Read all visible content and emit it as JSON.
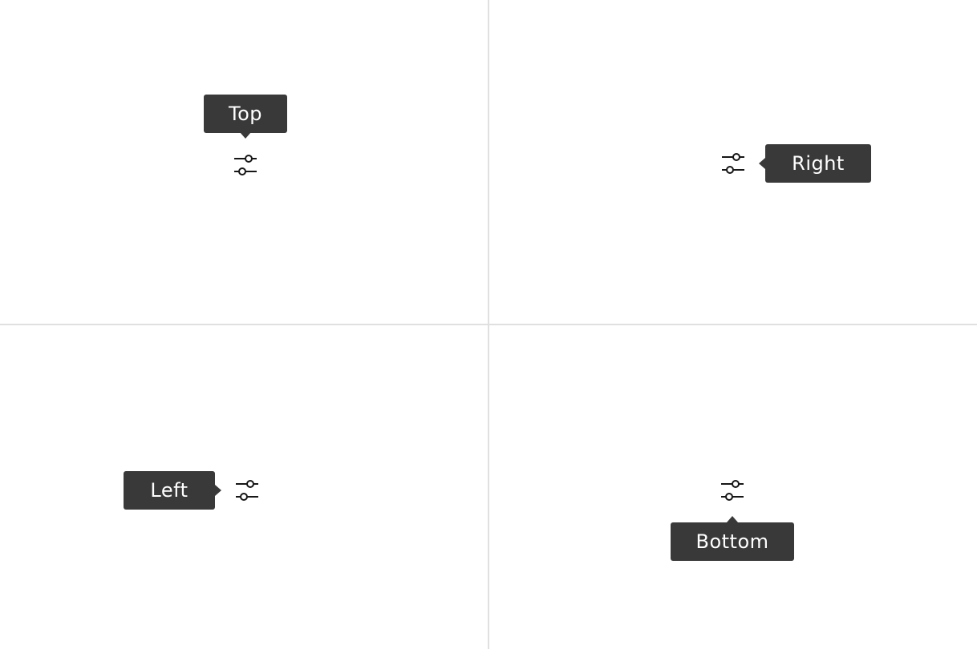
{
  "colors": {
    "tooltip_background": "#393939",
    "tooltip_text": "#ffffff",
    "divider": "#e0e0e0",
    "icon": "#161616",
    "background": "#ffffff"
  },
  "icon_name": "settings-adjust-icon",
  "quadrants": {
    "top": {
      "tooltip_label": "Top"
    },
    "right": {
      "tooltip_label": "Right"
    },
    "left": {
      "tooltip_label": "Left"
    },
    "bottom": {
      "tooltip_label": "Bottom"
    }
  }
}
